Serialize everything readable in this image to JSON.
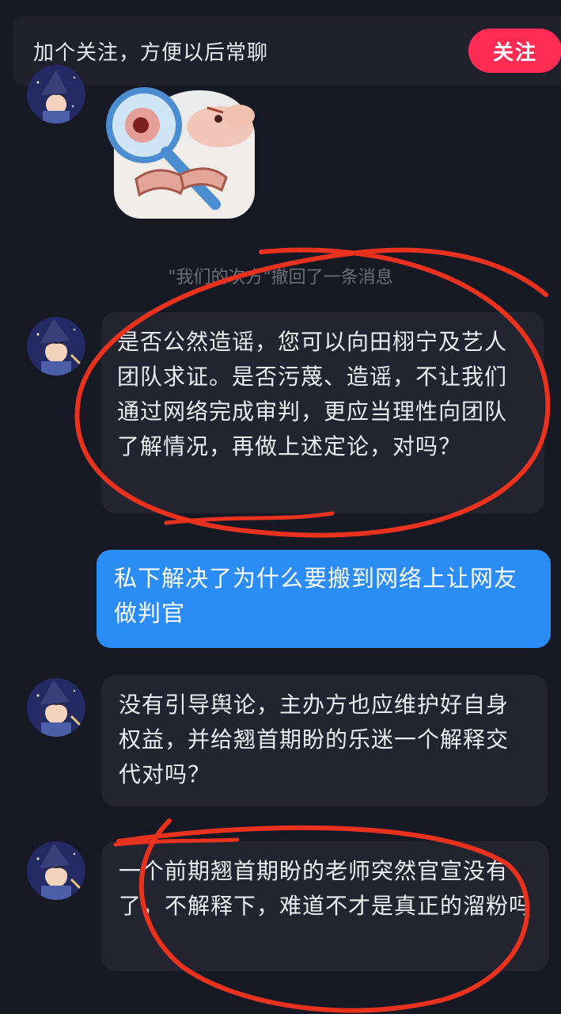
{
  "follow_banner": {
    "text": "加个关注，方便以后常聊",
    "button_label": "关注"
  },
  "recall_notice": "\"我们的次方\"撤回了一条消息",
  "messages": [
    {
      "side": "incoming",
      "type": "sticker",
      "icon": "magnifying-glass-sheep-sticker"
    },
    {
      "side": "incoming",
      "type": "text",
      "text": "是否公然造谣，您可以向田栩宁及艺人团队求证。是否污蔑、造谣，不让我们通过网络完成审判，更应当理性向团队了解情况，再做上述定论，对吗？"
    },
    {
      "side": "outgoing",
      "type": "text",
      "text": "私下解决了为什么要搬到网络上让网友做判官"
    },
    {
      "side": "incoming",
      "type": "text",
      "text": "没有引导舆论，主办方也应维护好自身权益，并给翘首期盼的乐迷一个解释交代对吗？"
    },
    {
      "side": "incoming",
      "type": "text",
      "text": "一个前期翘首期盼的老师突然官宣没有了，不解释下，难道不才是真正的溜粉吗"
    }
  ],
  "colors": {
    "background": "#161823",
    "incoming_bubble": "#23242f",
    "outgoing_bubble": "#2c8cf5",
    "follow_button": "#fe2c55",
    "annotation_stroke": "#e8321e"
  }
}
